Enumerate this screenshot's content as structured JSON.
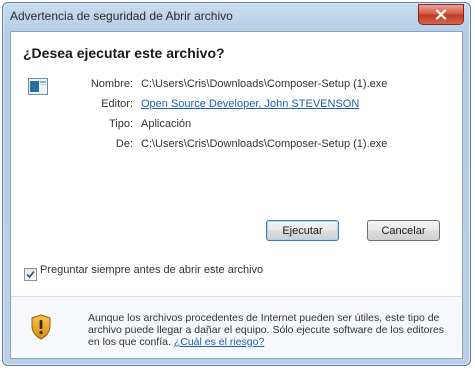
{
  "window": {
    "title": "Advertencia de seguridad de Abrir archivo"
  },
  "dialog": {
    "question": "¿Desea ejecutar este archivo?",
    "fields": {
      "name_label": "Nombre:",
      "name_value": "C:\\Users\\Cris\\Downloads\\Composer-Setup (1).exe",
      "publisher_label": "Editor:",
      "publisher_value": "Open Source Developer, John STEVENSON",
      "type_label": "Tipo:",
      "type_value": "Aplicación",
      "from_label": "De:",
      "from_value": "C:\\Users\\Cris\\Downloads\\Composer-Setup (1).exe"
    },
    "buttons": {
      "run": "Ejecutar",
      "cancel": "Cancelar"
    },
    "checkbox": {
      "label": "Preguntar siempre antes de abrir este archivo",
      "checked": true
    },
    "warning": {
      "text": "Aunque los archivos procedentes de Internet pueden ser útiles, este tipo de archivo puede llegar a dañar el equipo. Sólo ejecute software de los editores en los que confía.",
      "link": "¿Cuál es el riesgo?"
    }
  },
  "icons": {
    "close": "close-icon",
    "file": "application-file-icon",
    "shield": "security-shield-warning-icon",
    "check": "checkmark-icon"
  },
  "colors": {
    "link": "#1a5fb4",
    "close_button": "#c8442a",
    "shield": "#e8a317"
  }
}
